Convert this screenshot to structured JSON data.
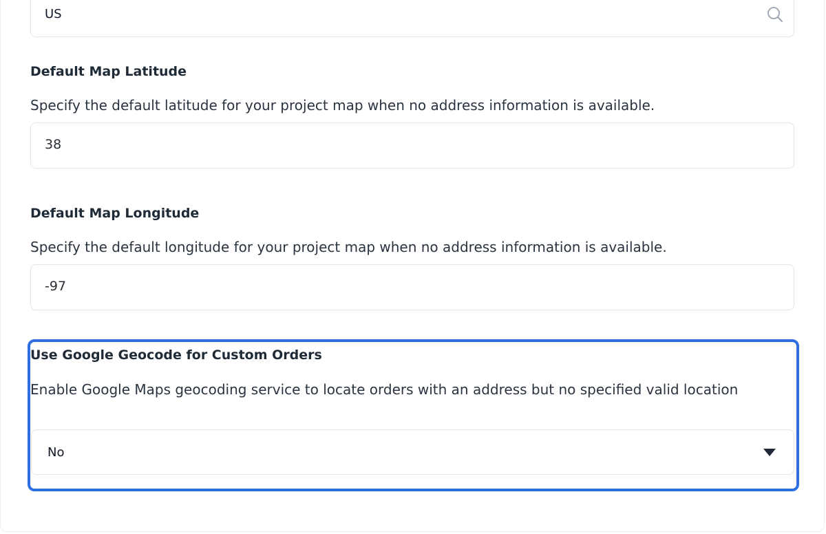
{
  "country_field": {
    "value": "US"
  },
  "latitude": {
    "label": "Default Map Latitude",
    "description": "Specify the default latitude for your project map when no address information is available.",
    "value": "38"
  },
  "longitude": {
    "label": "Default Map Longitude",
    "description": "Specify the default longitude for your project map when no address information is available.",
    "value": "-97"
  },
  "geocode": {
    "label": "Use Google Geocode for Custom Orders",
    "description": "Enable Google Maps geocoding service to locate orders with an address but no specified valid location",
    "selected": "No"
  },
  "colors": {
    "highlight": "#2f6ee0",
    "border": "#e3e5e8",
    "text": "#1f2937"
  }
}
